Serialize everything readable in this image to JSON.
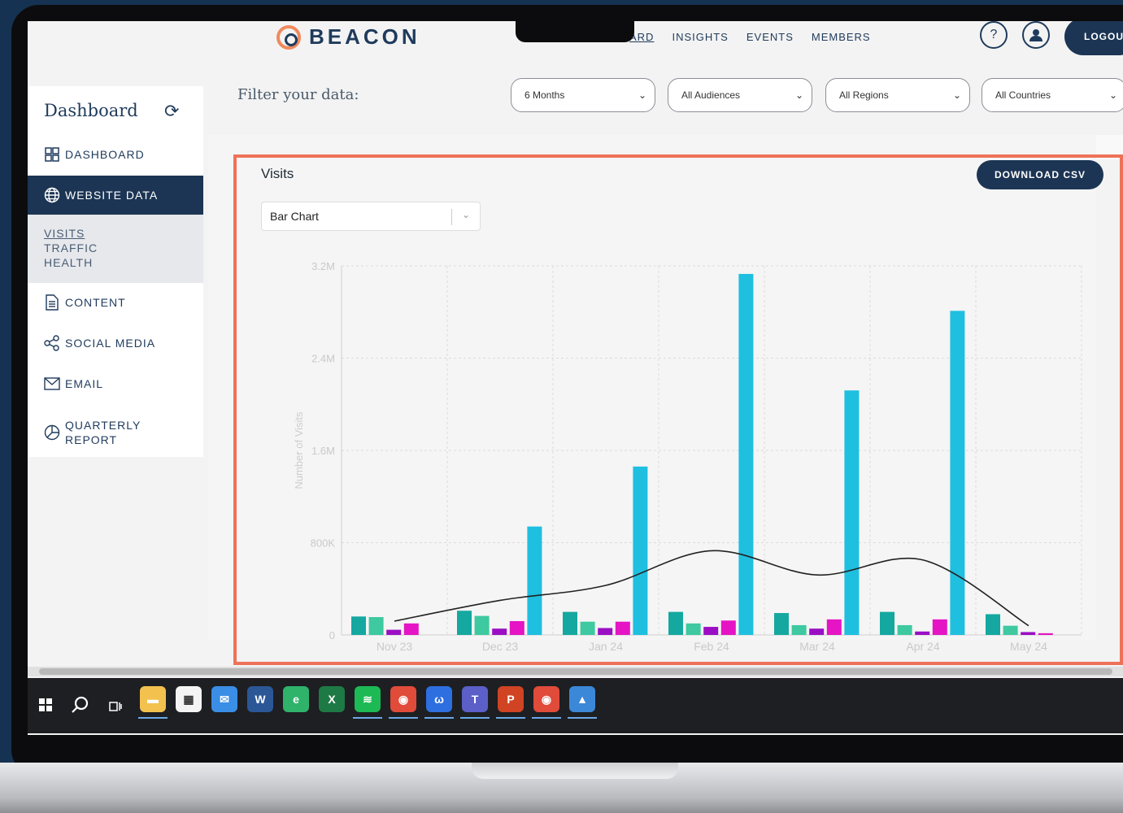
{
  "header": {
    "brand": "BEACON",
    "nav": [
      "ARD",
      "INSIGHTS",
      "EVENTS",
      "MEMBERS"
    ],
    "help_label": "?",
    "logout_label": "LOGOU"
  },
  "sidebar": {
    "title": "Dashboard",
    "items": [
      {
        "label": "DASHBOARD",
        "icon": "grid-icon"
      },
      {
        "label": "WEBSITE DATA",
        "icon": "globe-icon"
      },
      {
        "label": "CONTENT",
        "icon": "document-icon"
      },
      {
        "label": "SOCIAL MEDIA",
        "icon": "share-icon"
      },
      {
        "label": "EMAIL",
        "icon": "envelope-icon"
      },
      {
        "label": "QUARTERLY\nREPORT",
        "icon": "pie-chart-icon"
      }
    ],
    "subnav": [
      "VISITS",
      "TRAFFIC",
      "HEALTH"
    ]
  },
  "filters": {
    "label": "Filter your data:",
    "selects": [
      "6 Months",
      "All Audiences",
      "All Regions",
      "All Countries"
    ]
  },
  "card": {
    "title": "Visits",
    "download_label": "DOWNLOAD CSV",
    "chart_type_select": "Bar Chart"
  },
  "chart_data": {
    "type": "bar",
    "categories": [
      "Nov 23",
      "Dec 23",
      "Jan 24",
      "Feb 24",
      "Mar 24",
      "Apr 24",
      "May 24"
    ],
    "ylabel": "Number of Visits",
    "ylim": [
      0,
      3200000
    ],
    "yticks": [
      "0",
      "800K",
      "1.6M",
      "2.4M",
      "3.2M"
    ],
    "series": [
      {
        "color": "#14a8a0",
        "values": [
          160000,
          210000,
          200000,
          200000,
          190000,
          200000,
          180000
        ]
      },
      {
        "color": "#3ec9a0",
        "values": [
          155000,
          165000,
          115000,
          100000,
          85000,
          85000,
          80000
        ]
      },
      {
        "color": "#9a0fc4",
        "values": [
          45000,
          55000,
          60000,
          70000,
          55000,
          30000,
          25000
        ]
      },
      {
        "color": "#e514c4",
        "values": [
          100000,
          120000,
          115000,
          125000,
          135000,
          135000,
          15000
        ]
      },
      {
        "color": "#1fbfe0",
        "values": [
          0,
          940000,
          1460000,
          3130000,
          2120000,
          2810000,
          0
        ]
      }
    ],
    "trend_line": [
      120000,
      300000,
      430000,
      730000,
      520000,
      650000,
      80000
    ],
    "grid": true
  },
  "taskbar": {
    "apps": [
      {
        "name": "file-explorer-icon",
        "color": "#f2c14e",
        "glyph": "▬"
      },
      {
        "name": "store-icon",
        "color": "#f4f4f4",
        "glyph": "▦"
      },
      {
        "name": "mail-icon",
        "color": "#3a8ee6",
        "glyph": "✉"
      },
      {
        "name": "word-icon",
        "color": "#2b5797",
        "glyph": "W"
      },
      {
        "name": "edge-icon",
        "color": "#2fb36b",
        "glyph": "e"
      },
      {
        "name": "excel-icon",
        "color": "#1e7a45",
        "glyph": "X"
      },
      {
        "name": "spotify-icon",
        "color": "#1db954",
        "glyph": "≋"
      },
      {
        "name": "chrome-icon",
        "color": "#e04b3a",
        "glyph": "◉"
      },
      {
        "name": "webex-icon",
        "color": "#2d6fe0",
        "glyph": "ω"
      },
      {
        "name": "teams-icon",
        "color": "#5b5fc7",
        "glyph": "T"
      },
      {
        "name": "powerpoint-icon",
        "color": "#d04423",
        "glyph": "P"
      },
      {
        "name": "chrome-active-icon",
        "color": "#e04b3a",
        "glyph": "◉"
      },
      {
        "name": "photos-icon",
        "color": "#3c88d8",
        "glyph": "▲"
      }
    ]
  }
}
